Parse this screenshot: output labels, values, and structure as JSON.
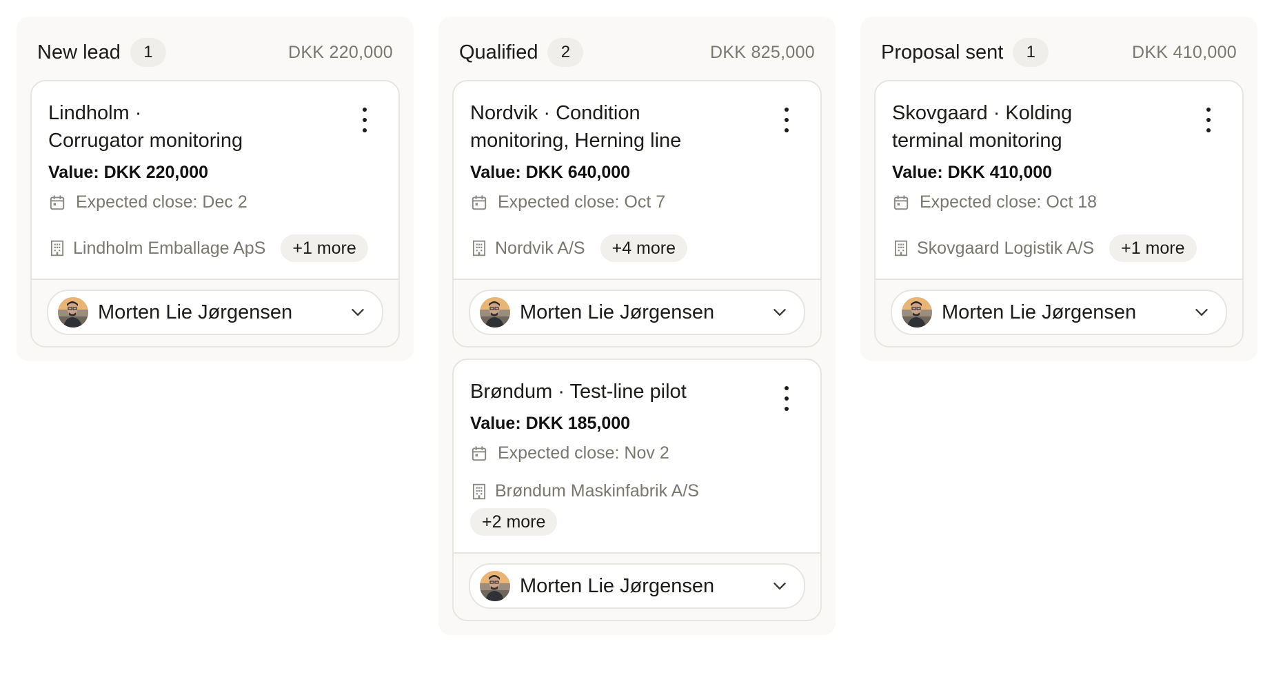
{
  "colors": {
    "column_bg": "#faf9f7",
    "card_border": "#e7e5e1",
    "muted_text": "#7a776f",
    "chip_bg": "#efeeeb"
  },
  "columns": [
    {
      "title": "New lead",
      "count": "1",
      "total": "DKK 220,000",
      "cards": [
        {
          "title_line1": "Lindholm ·",
          "title_line2": "Corrugator monitoring",
          "value": "Value: DKK 220,000",
          "close": "Expected close: Dec 2",
          "company": "Lindholm Emballage ApS",
          "more": "+1 more",
          "owner": "Morten Lie Jørgensen"
        }
      ]
    },
    {
      "title": "Qualified",
      "count": "2",
      "total": "DKK 825,000",
      "cards": [
        {
          "title_line1": "Nordvik · Condition",
          "title_line2": "monitoring, Herning line",
          "value": "Value: DKK 640,000",
          "close": "Expected close: Oct 7",
          "company": "Nordvik A/S",
          "more": "+4 more",
          "owner": "Morten Lie Jørgensen"
        },
        {
          "title_line1": "Brøndum · Test-line pilot",
          "value": "Value: DKK 185,000",
          "close": "Expected close: Nov 2",
          "company": "Brøndum Maskinfabrik A/S",
          "more": "+2 more",
          "owner": "Morten Lie Jørgensen"
        }
      ]
    },
    {
      "title": "Proposal sent",
      "count": "1",
      "total": "DKK 410,000",
      "cards": [
        {
          "title_line1": "Skovgaard · Kolding",
          "title_line2": "terminal monitoring",
          "value": "Value: DKK 410,000",
          "close": "Expected close: Oct 18",
          "company": "Skovgaard Logistik A/S",
          "more": "+1 more",
          "owner": "Morten Lie Jørgensen"
        }
      ]
    }
  ]
}
